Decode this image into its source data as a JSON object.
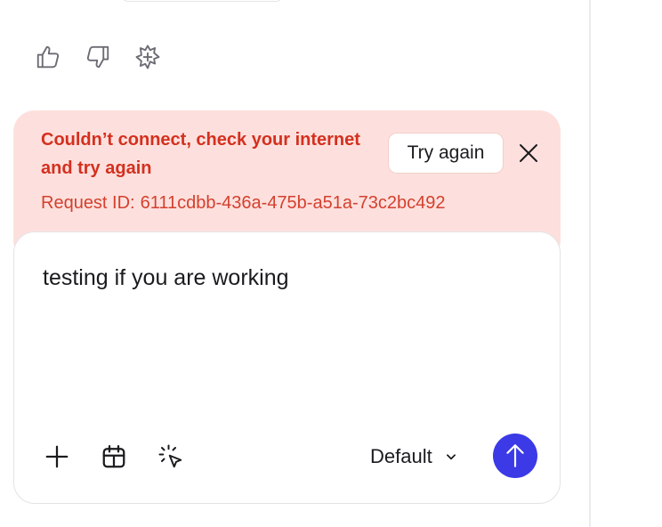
{
  "error": {
    "title": "Couldn’t connect, check your internet and try again",
    "request_id_label": "Request ID:",
    "request_id_value": "6111cdbb-436a-475b-a51a-73c2bc492",
    "retry_label": "Try again"
  },
  "composer": {
    "text": "testing if you are working",
    "model_label": "Default"
  },
  "icons": {
    "feedback": [
      "thumbs-up-icon",
      "thumbs-down-icon",
      "sparkle-plus-icon"
    ],
    "error": [
      "close-icon"
    ],
    "toolbar": [
      "plus-icon",
      "calendar-icon",
      "cursor-click-icon",
      "chevron-down-icon",
      "arrow-up-icon"
    ]
  },
  "colors": {
    "error_background": "#fde0dd",
    "error_text": "#d4301f",
    "send_button": "#3b3ae6"
  }
}
